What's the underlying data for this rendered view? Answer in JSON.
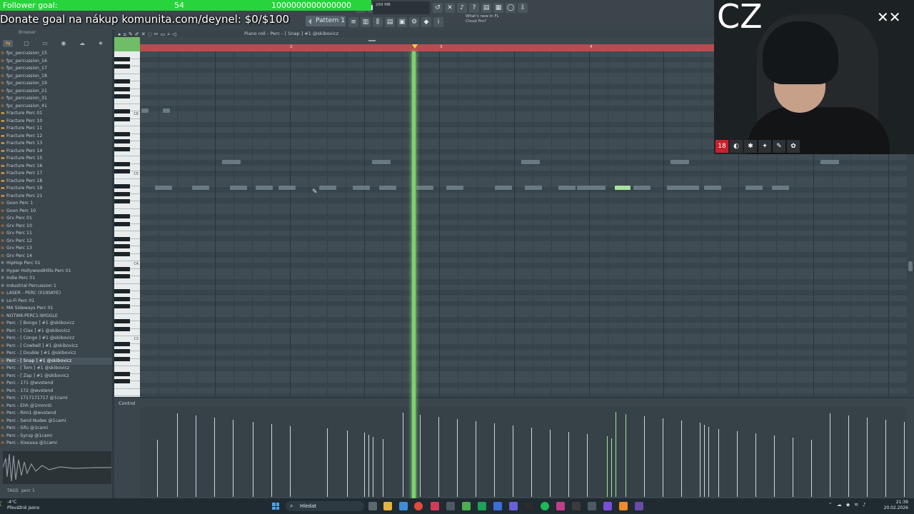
{
  "overlay": {
    "follower_label": "Follower goal:",
    "follower_count": "54",
    "follower_target": "1000000000000000",
    "donate": "Donate goal na nákup komunita.com/deynel: $0/$100"
  },
  "toolbar": {
    "pattern": "Pattern 1",
    "cpu": "269 MB",
    "news_line1": "What's new in FL",
    "news_line2": "Cloud Pro?"
  },
  "browser": {
    "title": "Browser",
    "items": [
      {
        "label": "fpc_percussion_15",
        "kind": "sample"
      },
      {
        "label": "fpc_percussion_16",
        "kind": "sample"
      },
      {
        "label": "fpc_percussion_17",
        "kind": "sample"
      },
      {
        "label": "fpc_percussion_18",
        "kind": "sample"
      },
      {
        "label": "fpc_percussion_19",
        "kind": "sample"
      },
      {
        "label": "fpc_percussion_21",
        "kind": "sample"
      },
      {
        "label": "fpc_percussion_31",
        "kind": "sample"
      },
      {
        "label": "fpc_percussion_41",
        "kind": "sample"
      },
      {
        "label": "Fracture Perc 01",
        "kind": "folder"
      },
      {
        "label": "Fracture Perc 10",
        "kind": "folder"
      },
      {
        "label": "Fracture Perc 11",
        "kind": "folder"
      },
      {
        "label": "Fracture Perc 12",
        "kind": "folder"
      },
      {
        "label": "Fracture Perc 13",
        "kind": "folder"
      },
      {
        "label": "Fracture Perc 14",
        "kind": "folder"
      },
      {
        "label": "Fracture Perc 15",
        "kind": "folder"
      },
      {
        "label": "Fracture Perc 16",
        "kind": "folder"
      },
      {
        "label": "Fracture Perc 17",
        "kind": "folder"
      },
      {
        "label": "Fracture Perc 18",
        "kind": "folder"
      },
      {
        "label": "Fracture Perc 19",
        "kind": "folder"
      },
      {
        "label": "Fracture Perc 21",
        "kind": "folder"
      },
      {
        "label": "Goon Perc 1",
        "kind": "sample"
      },
      {
        "label": "Goon Perc 10",
        "kind": "sample"
      },
      {
        "label": "Grv Perc 01",
        "kind": "sample"
      },
      {
        "label": "Grv Perc 10",
        "kind": "sample"
      },
      {
        "label": "Grv Perc 11",
        "kind": "sample"
      },
      {
        "label": "Grv Perc 12",
        "kind": "sample"
      },
      {
        "label": "Grv Perc 13",
        "kind": "sample"
      },
      {
        "label": "Grv Perc 14",
        "kind": "sample"
      },
      {
        "label": "HipHop Perc 01",
        "kind": "gear"
      },
      {
        "label": "Hyper HollywoodHills Perc 01",
        "kind": "gear"
      },
      {
        "label": "Indie Perc 01",
        "kind": "gear"
      },
      {
        "label": "Industrial Percussion 1",
        "kind": "gear"
      },
      {
        "label": "LASER - PERC (019SKYE)",
        "kind": "sample"
      },
      {
        "label": "Lo-Fi Perc 01",
        "kind": "gear"
      },
      {
        "label": "MA Sideways Perc 01",
        "kind": "sample"
      },
      {
        "label": "NOTWK-PERC1-WIGGLE",
        "kind": "sample"
      },
      {
        "label": "Perc - [ Bongo ] #1 @skibovicz",
        "kind": "sample"
      },
      {
        "label": "Perc - [ Clax ] #1 @skibovicz",
        "kind": "sample"
      },
      {
        "label": "Perc - [ Congo ] #1 @skibovicz",
        "kind": "sample"
      },
      {
        "label": "Perc - [ Cowbell ] #1 @skibovicz",
        "kind": "sample"
      },
      {
        "label": "Perc - [ Double ] #1 @skibovicz",
        "kind": "sample"
      },
      {
        "label": "Perc - [ Snap ] #1 @skibovicz",
        "kind": "selected"
      },
      {
        "label": "Perc - [ Tom ] #1 @skibovicz",
        "kind": "sample"
      },
      {
        "label": "Perc - [ Zap ] #1 @skibovicz",
        "kind": "sample"
      },
      {
        "label": "Perc - 171 @wvstend",
        "kind": "sample"
      },
      {
        "label": "Perc - 172 @wvstend",
        "kind": "sample"
      },
      {
        "label": "Perc - 1717171717 @1cami",
        "kind": "sample"
      },
      {
        "label": "Perc - Ehh @1mmnti",
        "kind": "sample"
      },
      {
        "label": "Perc - Rim1 @wvstend",
        "kind": "sample"
      },
      {
        "label": "Perc - Send Nudes @1cami",
        "kind": "sample"
      },
      {
        "label": "Perc - Sifu @1cami",
        "kind": "sample"
      },
      {
        "label": "Perc - Syrup @1cami",
        "kind": "sample"
      },
      {
        "label": "Perc - Xixouxa @1cami",
        "kind": "sample"
      }
    ],
    "footer_tags": "TAGS",
    "footer_value": "perc 1"
  },
  "piano_roll": {
    "title": "Piano roll - Perc - [ Snap ] #1 @skibovicz",
    "control_label": "Control",
    "timeline_numbers": [
      "2",
      "3",
      "4"
    ],
    "octave_labels": [
      "C6",
      "C5",
      "C4",
      "C3"
    ],
    "notes_c5": [
      0.2,
      0.7,
      1.2,
      1.55,
      1.85,
      2.4,
      2.85,
      3.2,
      3.7,
      4.1,
      4.75,
      5.15,
      5.6,
      5.85,
      6.0,
      6.35,
      6.6,
      7.05,
      7.25,
      7.55,
      8.1,
      8.45
    ],
    "notes_high": [
      1.1,
      3.1,
      5.1,
      7.1,
      9.1
    ],
    "selected_note_position": 6.35
  },
  "webcam": {
    "sign": "CZ",
    "doodle": "✕✕",
    "badges": [
      "18",
      "◐",
      "✱",
      "✦",
      "✎",
      "✿"
    ]
  },
  "taskbar": {
    "weather_temp": "-4°C",
    "weather_desc": "Převážně jasno",
    "search": "Hledat",
    "time": "21:39",
    "date": "20.02.2026"
  }
}
